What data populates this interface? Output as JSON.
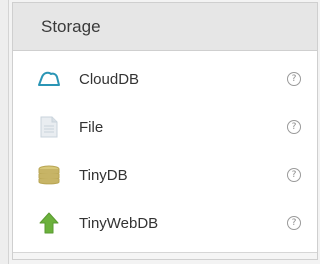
{
  "palette": {
    "title": "Storage",
    "items": [
      {
        "label": "CloudDB",
        "icon": "cloud-icon",
        "help": "?"
      },
      {
        "label": "File",
        "icon": "file-icon",
        "help": "?"
      },
      {
        "label": "TinyDB",
        "icon": "database-icon",
        "help": "?"
      },
      {
        "label": "TinyWebDB",
        "icon": "upload-arrow-icon",
        "help": "?"
      }
    ]
  },
  "colors": {
    "header_bg": "#e6e6e6",
    "cloud": "#2a95b5",
    "file": "#c9d3dc",
    "database": "#c7b466",
    "arrow": "#6bb13c"
  }
}
